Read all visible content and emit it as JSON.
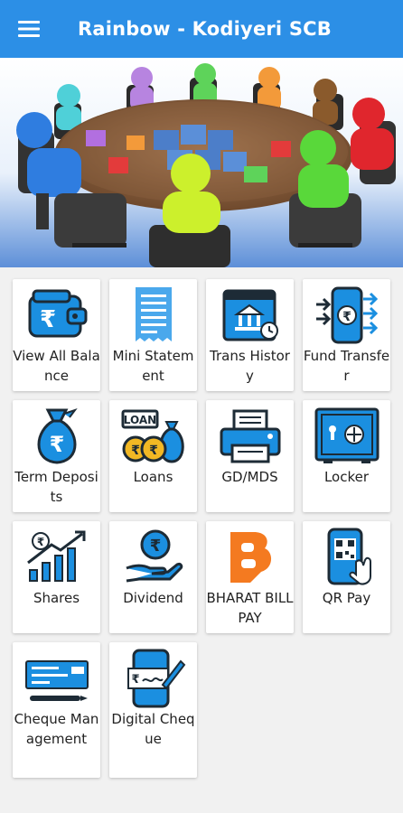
{
  "appbar": {
    "title": "Rainbow - Kodiyeri SCB",
    "menu_icon": "hamburger-menu-icon",
    "color": "#2c8fe6"
  },
  "banner": {
    "image": "team-meeting-puzzle-table-illustration"
  },
  "tiles": [
    {
      "label": "View All Balance",
      "icon": "wallet-rupee-icon"
    },
    {
      "label": "Mini Statement",
      "icon": "receipt-icon"
    },
    {
      "label": "Trans History",
      "icon": "bank-history-icon"
    },
    {
      "label": "Fund Transfer",
      "icon": "phone-transfer-icon"
    },
    {
      "label": "Term Deposits",
      "icon": "money-bag-icon"
    },
    {
      "label": "Loans",
      "icon": "loan-coins-icon"
    },
    {
      "label": "GD/MDS",
      "icon": "printer-icon"
    },
    {
      "label": "Locker",
      "icon": "safe-icon"
    },
    {
      "label": "Shares",
      "icon": "growth-chart-icon"
    },
    {
      "label": "Dividend",
      "icon": "hand-coin-icon"
    },
    {
      "label": "BHARAT BILLPAY",
      "icon": "bharat-billpay-logo-icon"
    },
    {
      "label": "QR Pay",
      "icon": "qr-phone-icon"
    },
    {
      "label": "Cheque Management",
      "icon": "cheque-icon"
    },
    {
      "label": "Digital Cheque",
      "icon": "digital-cheque-icon"
    }
  ],
  "colors": {
    "icon_blue": "#1b8fe0",
    "icon_dark": "#1d2b36",
    "billpay_orange": "#f47a20",
    "grid_bg": "#f1f1f1"
  }
}
